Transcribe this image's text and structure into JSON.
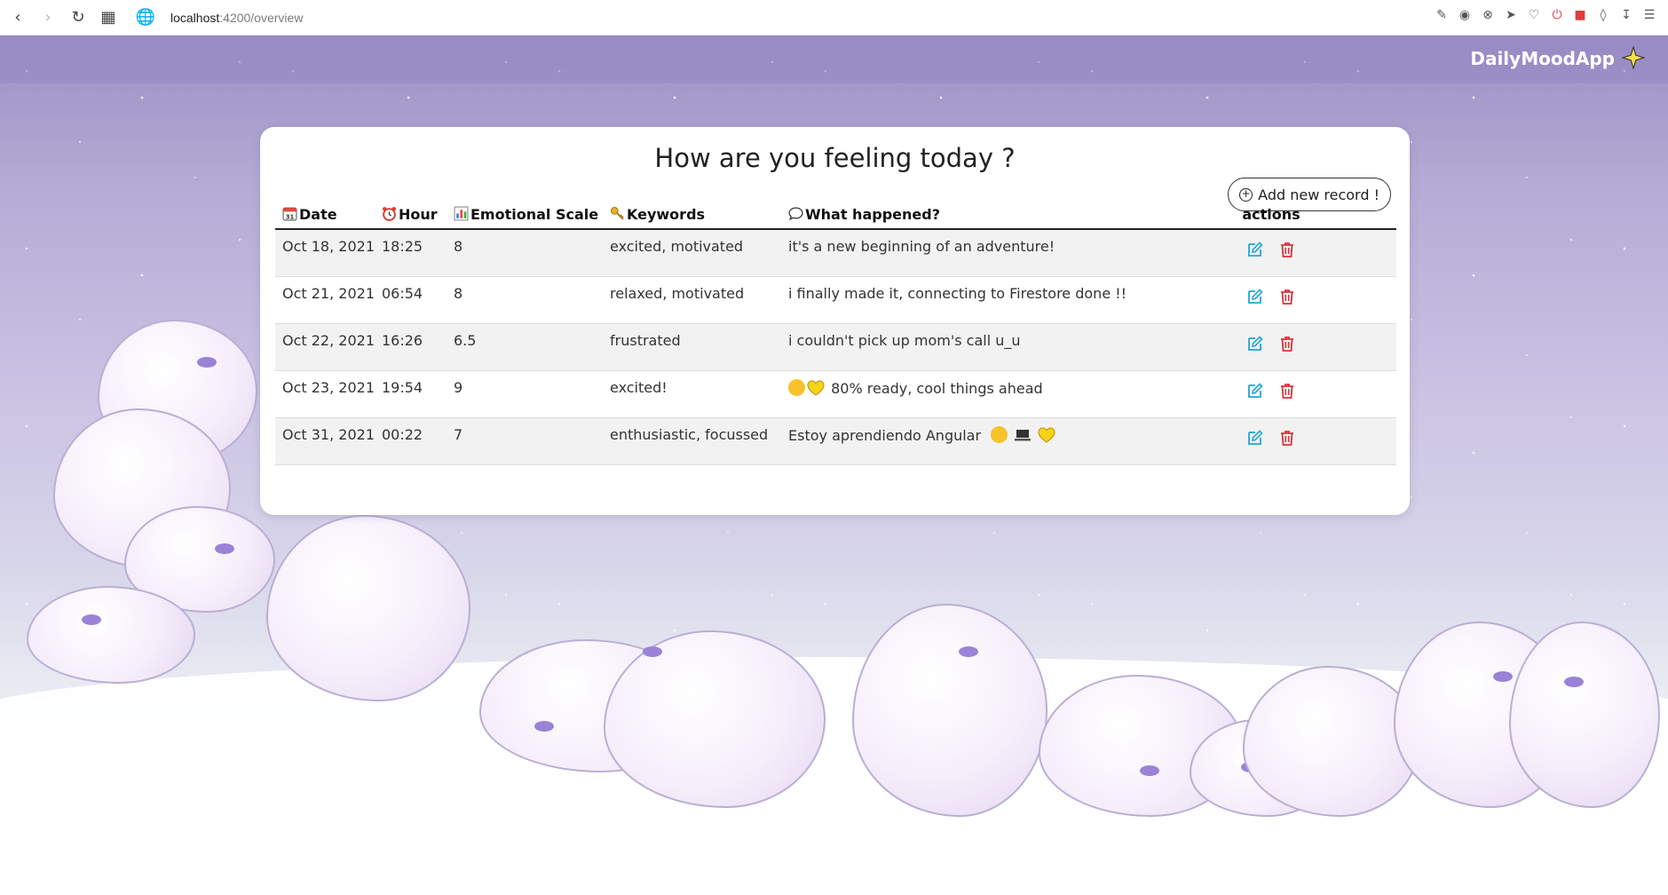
{
  "browser": {
    "url_host": "localhost",
    "url_path": ":4200/overview"
  },
  "app": {
    "brand": "DailyMoodApp"
  },
  "card": {
    "title": "How are you feeling today ?",
    "add_button": "Add new record !"
  },
  "table": {
    "headers": {
      "date": "Date",
      "hour": "Hour",
      "scale": "Emotional Scale",
      "keywords": "Keywords",
      "what": "What happened?",
      "actions": "actions"
    },
    "rows": [
      {
        "date": "Oct 18, 2021",
        "hour": "18:25",
        "scale": "8",
        "keywords": "excited, motivated",
        "what": "it's a new beginning of an adventure!"
      },
      {
        "date": "Oct 21, 2021",
        "hour": "06:54",
        "scale": "8",
        "keywords": "relaxed, motivated",
        "what": "i finally made it, connecting to Firestore done !!"
      },
      {
        "date": "Oct 22, 2021",
        "hour": "16:26",
        "scale": "6.5",
        "keywords": "frustrated",
        "what": "i couldn't pick up mom's call u_u"
      },
      {
        "date": "Oct 23, 2021",
        "hour": "19:54",
        "scale": "9",
        "keywords": "excited!",
        "what": "80% ready, cool things ahead"
      },
      {
        "date": "Oct 31, 2021",
        "hour": "00:22",
        "scale": "7",
        "keywords": "enthusiastic, focussed",
        "what": "Estoy aprendiendo Angular"
      }
    ]
  },
  "colors": {
    "edit": "#1fa7d6",
    "delete": "#d9323b",
    "header_bg": "#9a8bc5"
  }
}
